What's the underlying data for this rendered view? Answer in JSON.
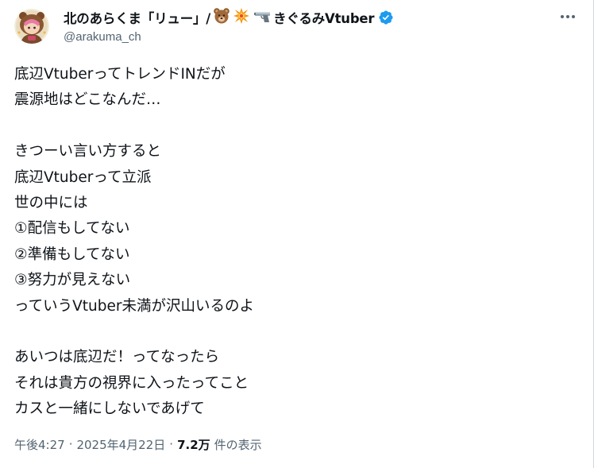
{
  "author": {
    "display_name": "北のあらくま「リュー」/",
    "name_suffix": "きぐるみVtuber",
    "handle": "@arakuma_ch",
    "emoji_icons": [
      "bear-face-icon",
      "collision-icon",
      "pistol-icon"
    ],
    "verified_color": "#1d9bf0"
  },
  "tweet": {
    "text": "底辺VtuberってトレンドINだが\n震源地はどこなんだ…\n\nきつーい言い方すると\n底辺Vtuberって立派\n世の中には\n①配信もしてない\n②準備もしてない\n③努力が見えない\nっていうVtuber未満が沢山いるのよ\n\nあいつは底辺だ！ってなったら\nそれは貴方の視界に入ったってこと\nカスと一緒にしないであげて"
  },
  "meta": {
    "time": "午後4:27",
    "separator": "·",
    "date": "2025年4月22日",
    "views_count": "7.2万",
    "views_label": "件の表示"
  },
  "colors": {
    "text": "#0f1419",
    "secondary": "#536471",
    "accent": "#1d9bf0"
  }
}
